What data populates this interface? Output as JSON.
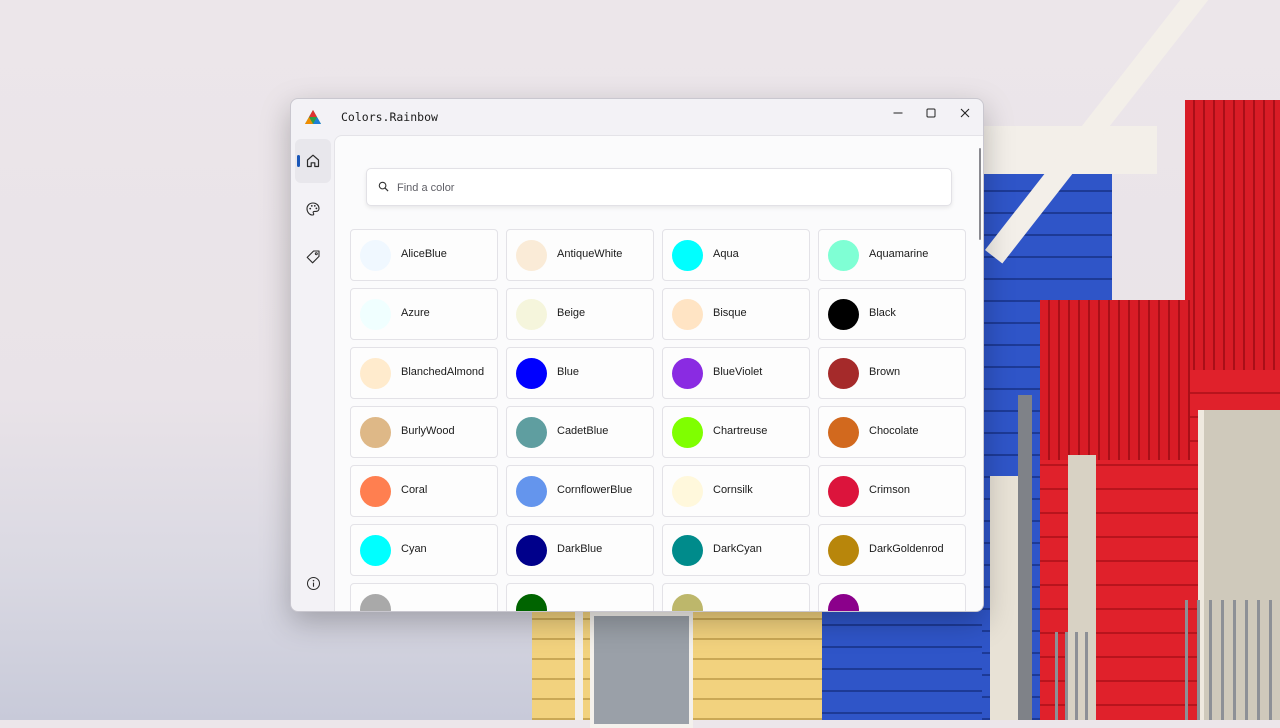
{
  "window": {
    "title": "Colors.Rainbow",
    "controls": [
      "minimize-icon",
      "maximize-icon",
      "close-icon"
    ]
  },
  "sidebar": {
    "items": [
      {
        "icon": "home-icon",
        "active": true
      },
      {
        "icon": "palette-icon",
        "active": false
      },
      {
        "icon": "tag-icon",
        "active": false
      }
    ],
    "footer_icon": "info-icon"
  },
  "search": {
    "placeholder": "Find a color",
    "value": ""
  },
  "colors": [
    {
      "name": "AliceBlue",
      "hex": "#F0F8FF"
    },
    {
      "name": "AntiqueWhite",
      "hex": "#FAEBD7"
    },
    {
      "name": "Aqua",
      "hex": "#00FFFF"
    },
    {
      "name": "Aquamarine",
      "hex": "#7FFFD4"
    },
    {
      "name": "Azure",
      "hex": "#F0FFFF"
    },
    {
      "name": "Beige",
      "hex": "#F5F5DC"
    },
    {
      "name": "Bisque",
      "hex": "#FFE4C4"
    },
    {
      "name": "Black",
      "hex": "#000000"
    },
    {
      "name": "BlanchedAlmond",
      "hex": "#FFEBCD"
    },
    {
      "name": "Blue",
      "hex": "#0000FF"
    },
    {
      "name": "BlueViolet",
      "hex": "#8A2BE2"
    },
    {
      "name": "Brown",
      "hex": "#A52A2A"
    },
    {
      "name": "BurlyWood",
      "hex": "#DEB887"
    },
    {
      "name": "CadetBlue",
      "hex": "#5F9EA0"
    },
    {
      "name": "Chartreuse",
      "hex": "#7FFF00"
    },
    {
      "name": "Chocolate",
      "hex": "#D2691E"
    },
    {
      "name": "Coral",
      "hex": "#FF7F50"
    },
    {
      "name": "CornflowerBlue",
      "hex": "#6495ED"
    },
    {
      "name": "Cornsilk",
      "hex": "#FFF8DC"
    },
    {
      "name": "Crimson",
      "hex": "#DC143C"
    },
    {
      "name": "Cyan",
      "hex": "#00FFFF"
    },
    {
      "name": "DarkBlue",
      "hex": "#00008B"
    },
    {
      "name": "DarkCyan",
      "hex": "#008B8B"
    },
    {
      "name": "DarkGoldenrod",
      "hex": "#B8860B"
    },
    {
      "name": "",
      "hex": "#A9A9A9"
    },
    {
      "name": "",
      "hex": "#006400"
    },
    {
      "name": "",
      "hex": "#BDB76B"
    },
    {
      "name": "",
      "hex": "#8B008B"
    }
  ],
  "theme": {
    "accent": "#1A57B8"
  }
}
